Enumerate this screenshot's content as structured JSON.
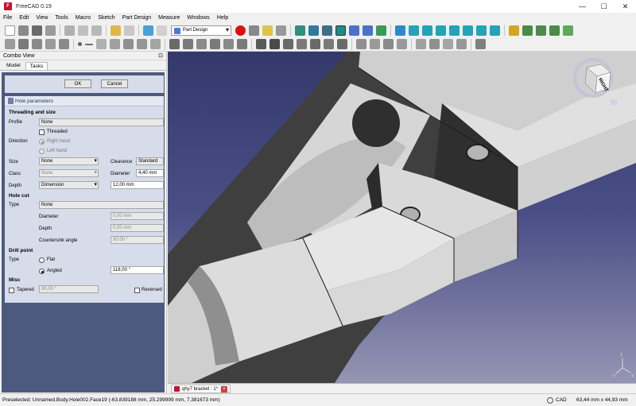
{
  "window": {
    "title": "FreeCAD 0.19",
    "app_icon_letter": "F"
  },
  "menus": [
    "File",
    "Edit",
    "View",
    "Tools",
    "Macro",
    "Sketch",
    "Part Design",
    "Measure",
    "Windows",
    "Help"
  ],
  "toolbar": {
    "workbench": "Part Design"
  },
  "combo_view": {
    "title": "Combo View",
    "float_glyph": "⊡",
    "tabs": [
      "Model",
      "Tasks"
    ]
  },
  "buttons": {
    "ok": "OK",
    "cancel": "Cancel"
  },
  "hole": {
    "panel_title": "Hole parameters",
    "threading_section": "Threading and size",
    "profile_label": "Profile",
    "profile_value": "None",
    "threaded_label": "Threaded",
    "direction_label": "Direction",
    "right_hand": "Right hand",
    "left_hand": "Left hand",
    "size_label": "Size",
    "size_value": "None",
    "clearance_label": "Clearance",
    "clearance_value": "Standard",
    "class_label": "Class",
    "class_value": "None",
    "diameter_label": "Diameter",
    "diameter_value": "4,40 mm",
    "depth_label": "Depth",
    "depth_mode": "Dimension",
    "depth_value": "12,00 mm",
    "holecut_section": "Hole cut",
    "type_label": "Type",
    "cut_type": "None",
    "cut_diameter_label": "Diameter",
    "cut_diameter_value": "0,00 mm",
    "cut_depth_label": "Depth",
    "cut_depth_value": "0,00 mm",
    "countersink_label": "Countersink angle",
    "countersink_value": "90,00 °",
    "drill_section": "Drill point",
    "drill_type_label": "Type",
    "flat_label": "Flat",
    "angled_label": "Angled",
    "angled_value": "118,00 °",
    "misc_section": "Misc",
    "tapered_label": "Tapered",
    "tapered_value": "90,00 °",
    "reversed_label": "Reversed"
  },
  "viewport": {
    "navcube_face": "RIGHT",
    "axis_labels": [
      "Z",
      "Y",
      "X"
    ]
  },
  "document_tab": {
    "label": "qhy7 bracket : 1*",
    "close_glyph": "×"
  },
  "status": {
    "message": "Preselected: Unnamed.Body.Hole002.Face19 (-63.839188 mm, 25.299999 mm, 7.381673 mm)",
    "nav_style": "CAD",
    "dimensions": "63,44 mm x 44,93 mm"
  },
  "colors": {
    "viewport_top": "#34396c",
    "viewport_bottom": "#9595b3",
    "task_background": "#4d5a80",
    "panel_background": "#d7dcea"
  }
}
